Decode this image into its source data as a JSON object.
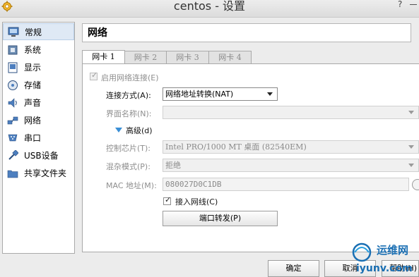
{
  "window": {
    "title": "centos - 设置",
    "help_glyph": "?"
  },
  "sidebar": {
    "items": [
      {
        "label": "常规",
        "icon": "general-icon"
      },
      {
        "label": "系统",
        "icon": "system-icon"
      },
      {
        "label": "显示",
        "icon": "display-icon"
      },
      {
        "label": "存储",
        "icon": "storage-icon"
      },
      {
        "label": "声音",
        "icon": "audio-icon"
      },
      {
        "label": "网络",
        "icon": "network-icon"
      },
      {
        "label": "串口",
        "icon": "serial-port-icon"
      },
      {
        "label": "USB设备",
        "icon": "usb-icon"
      },
      {
        "label": "共享文件夹",
        "icon": "shared-folder-icon"
      }
    ],
    "selected_index": 0
  },
  "page": {
    "title": "网络"
  },
  "tabs": [
    "网卡 1",
    "网卡 2",
    "网卡 3",
    "网卡 4"
  ],
  "form": {
    "enable_adapter": {
      "label": "启用网络连接(E)",
      "checked": true
    },
    "attached_to": {
      "label": "连接方式(A):",
      "value": "网络地址转换(NAT)"
    },
    "name": {
      "label": "界面名称(N):",
      "value": ""
    },
    "advanced": {
      "label": "高级(d)"
    },
    "adapter_type": {
      "label": "控制芯片(T):",
      "value": "Intel PRO/1000 MT 桌面 (82540EM)"
    },
    "promiscuous": {
      "label": "混杂模式(P):",
      "value": "拒绝"
    },
    "mac": {
      "label": "MAC 地址(M):",
      "value": "080027D0C1DB"
    },
    "cable": {
      "label": "接入网线(C)",
      "checked": true
    },
    "port_forwarding": {
      "label": "端口转发(P)"
    }
  },
  "buttons": {
    "ok": "确定",
    "cancel": "取消",
    "help": "帮助(H)"
  },
  "watermark": {
    "line1": "运维网",
    "line2": "iyunv.com"
  },
  "colors": {
    "accent": "#3a8fd6",
    "selection": "#dfe9f5",
    "watermark": "#1a6fb3"
  }
}
